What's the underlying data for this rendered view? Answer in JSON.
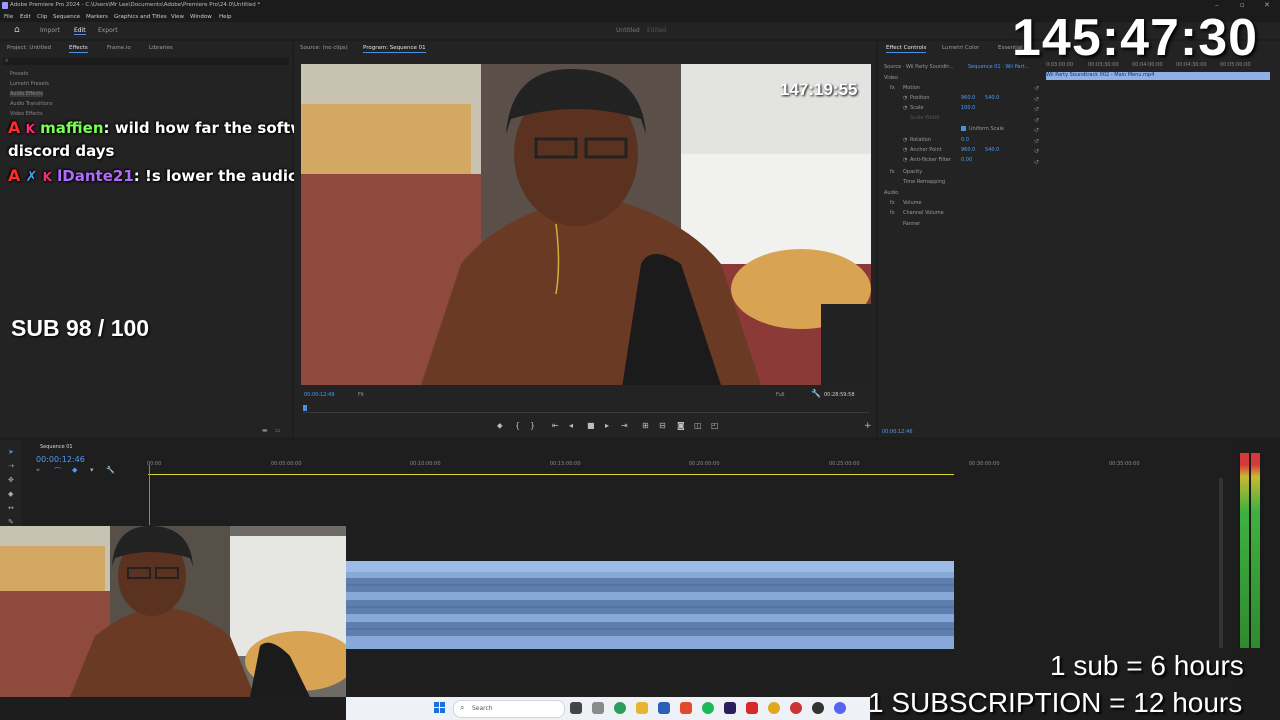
{
  "window": {
    "title": "Adobe Premiere Pro 2024 - C:\\Users\\Mr Lee\\Documents\\Adobe\\Premiere Pro\\24.0\\Untitled *"
  },
  "menu": [
    "File",
    "Edit",
    "Clip",
    "Sequence",
    "Markers",
    "Graphics and Titles",
    "View",
    "Window",
    "Help"
  ],
  "workspace": {
    "tabs": [
      "Import",
      "Edit",
      "Export"
    ],
    "active": "Edit",
    "project_name": "Untitled",
    "project_status": "Edited"
  },
  "left_panel": {
    "tabs": [
      "Project: Untitled",
      "Effects",
      "Frame.io",
      "Libraries"
    ],
    "active_tab": "Effects",
    "tree": [
      "Presets",
      "Lumetri Presets",
      "Audio Effects",
      "Audio Transitions",
      "Video Effects"
    ]
  },
  "chat": [
    {
      "user": "maffien",
      "message": ": wild how far the software has come since those basic",
      "message2": "discord days"
    },
    {
      "user": "lDante21",
      "message": ": !s lower the audio"
    }
  ],
  "subgoal": "SUB 98 / 100",
  "source_monitor": {
    "tab": "Source: (no clips)"
  },
  "program_monitor": {
    "tab": "Program: Sequence 01",
    "timecode_left": "00:00:12:49",
    "fit": "Fit",
    "quality": "Full",
    "timecode_right": "00:28:59:58",
    "overlay_timer": "147:19:55"
  },
  "effect_controls": {
    "tabs": [
      "Effect Controls",
      "Lumetri Color",
      "Essential"
    ],
    "source": "Source · Wii Party Soundtr...",
    "sequence": "Sequence 01 · Wii Part...",
    "clip_name": "Wii Party Soundtrack 002 - Main Menu.mp4",
    "sections": {
      "video": "Video",
      "motion": "Motion",
      "position": {
        "label": "Position",
        "x": "960.0",
        "y": "540.0"
      },
      "scale": {
        "label": "Scale",
        "value": "100.0"
      },
      "scale_width": "Scale Width",
      "uniform_scale": "Uniform Scale",
      "rotation": {
        "label": "Rotation",
        "value": "0.0"
      },
      "anchor": {
        "label": "Anchor Point",
        "x": "960.0",
        "y": "540.0"
      },
      "antiflicker": {
        "label": "Anti-flicker Filter",
        "value": "0.00"
      },
      "opacity": "Opacity",
      "time_remap": "Time Remapping",
      "audio": "Audio",
      "volume": "Volume",
      "channel_volume": "Channel Volume",
      "panner": "Panner"
    },
    "ruler": [
      "0:03:00:00",
      "00:03:30:00",
      "00:04:00:00",
      "00:04:30:00",
      "00:05:00:00"
    ],
    "timecode": "00:00:12:46"
  },
  "timeline": {
    "tab": "Sequence 01",
    "timecode": "00:00:12:46",
    "ruler": [
      "00:00",
      "00:05:00:00",
      "00:10:00:00",
      "00:15:00:00",
      "00:20:00:00",
      "00:25:00:00",
      "00:30:00:00",
      "00:35:00:00"
    ]
  },
  "stream": {
    "timer": "145:47:30",
    "overlay_line1": "1 sub = 6 hours",
    "overlay_line2": "1 SUBSCRIPTION = 12 hours"
  },
  "taskbar": {
    "search_placeholder": "Search"
  }
}
